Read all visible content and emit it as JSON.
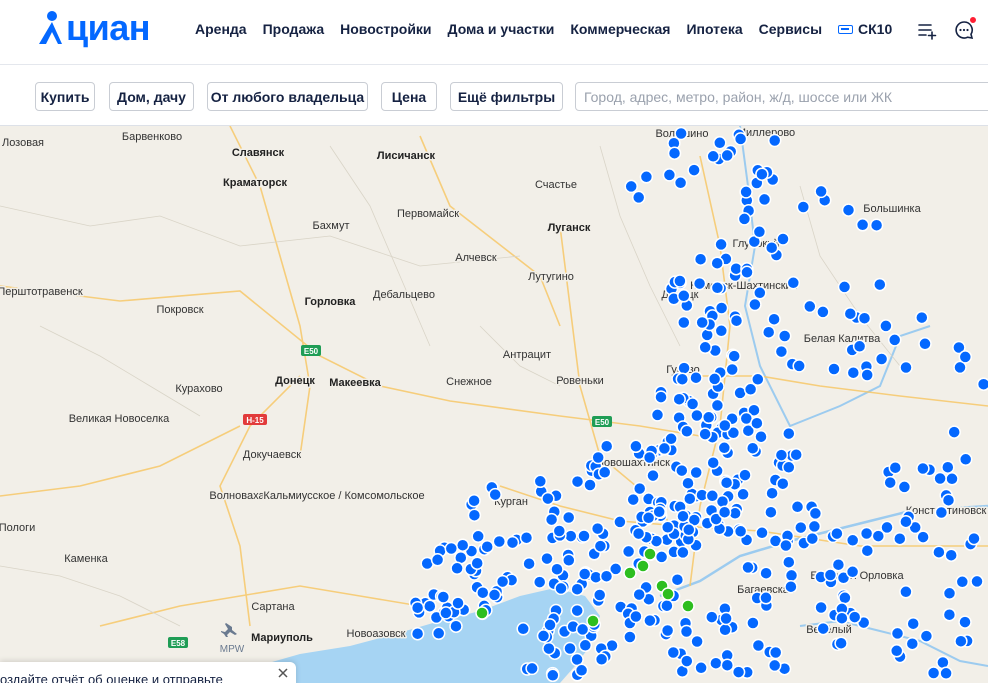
{
  "header": {
    "logo_text": "циан",
    "nav": [
      "Аренда",
      "Продажа",
      "Новостройки",
      "Дома и участки",
      "Коммерческая",
      "Ипотека",
      "Сервисы"
    ],
    "badge_label": "СК10",
    "icons": [
      "compare-list-icon",
      "chat-icon"
    ]
  },
  "filters": {
    "deal": "Купить",
    "type": "Дом, дачу",
    "owner": "От любого владельца",
    "price": "Цена",
    "more": "Ещё фильтры",
    "search_placeholder": "Город, адрес, метро, район, ж/д, шоссе или ЖК"
  },
  "map": {
    "cities": [
      "Волошино",
      "Миллерово",
      "Барвенково",
      "Лозовая",
      "Славянск",
      "Лисичанск",
      "Краматорск",
      "Счастье",
      "Большинка",
      "Бахмут",
      "Первомайск",
      "Луганск",
      "Глубокий",
      "Перштотравенск",
      "Алчевск",
      "Лутугино",
      "Донецк",
      "Каменск-Шахтинский",
      "Горловка",
      "Дебальцево",
      "Белая Калитва",
      "Покровск",
      "Антрацит",
      "Гуково",
      "Курахово",
      "Донецк",
      "Макеевка",
      "Снежное",
      "Ровеньки",
      "Великая Новоселка",
      "Новошахтинск",
      "Докучаевск",
      "Волноваха",
      "Кальмиусское / Комсомольское",
      "Курган",
      "Константиновск",
      "Пологи",
      "Каменка",
      "Большая Орловка",
      "Сартана",
      "Мариуполь",
      "Новоазовск",
      "Багаевская",
      "Весёлый"
    ],
    "roads": [
      "E50",
      "H-15",
      "E50",
      "E58"
    ],
    "airport_code": "MPW"
  },
  "toast": {
    "text": "оздайте отчёт об оценке и отправьте"
  },
  "colors": {
    "accent": "#0468ff",
    "listing_dot": "#0468ff",
    "new_listing_dot": "#2dbe1f",
    "sea": "#a6d4f3",
    "notification": "#ff1f34"
  }
}
